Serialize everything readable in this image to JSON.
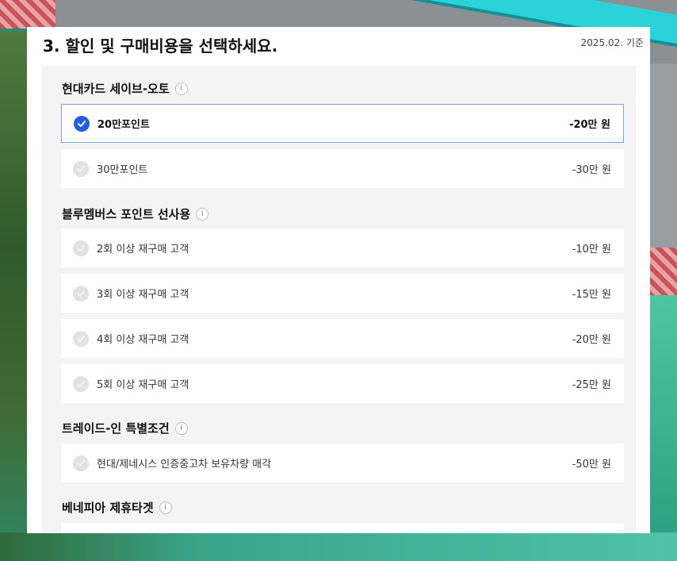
{
  "header": {
    "title": "3. 할인 및 구매비용을 선택하세요.",
    "ref_date": "2025.02. 기준"
  },
  "sections": [
    {
      "title": "현대카드 세이브-오토",
      "options": [
        {
          "label": "20만포인트",
          "value": "-20만 원",
          "selected": true
        },
        {
          "label": "30만포인트",
          "value": "-30만 원",
          "selected": false
        }
      ]
    },
    {
      "title": "블루멤버스 포인트 선사용",
      "options": [
        {
          "label": "2회 이상 재구매 고객",
          "value": "-10만 원",
          "selected": false
        },
        {
          "label": "3회 이상 재구매 고객",
          "value": "-15만 원",
          "selected": false
        },
        {
          "label": "4회 이상 재구매 고객",
          "value": "-20만 원",
          "selected": false
        },
        {
          "label": "5회 이상 재구매 고객",
          "value": "-25만 원",
          "selected": false
        }
      ]
    },
    {
      "title": "트레이드-인 특별조건",
      "options": [
        {
          "label": "현대/제네시스 인증중고차 보유차량 매각",
          "value": "-50만 원",
          "selected": false
        }
      ]
    },
    {
      "title": "베네피아 제휴타겟",
      "options": []
    }
  ],
  "icons": {
    "info": "i",
    "check": "check-icon"
  },
  "colors": {
    "accent": "#1f5fe0",
    "selected_border": "#7ea3e6",
    "unselected_check": "#e2e2e2"
  }
}
